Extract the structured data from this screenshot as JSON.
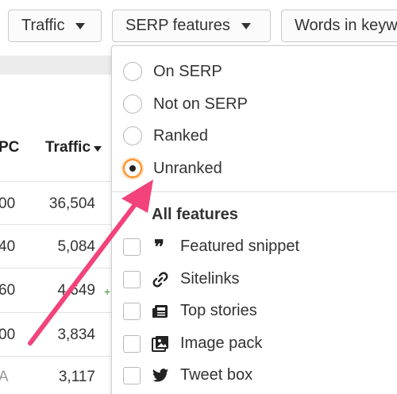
{
  "filters": {
    "traffic": "Traffic",
    "serp_features": "SERP features",
    "words_in_keyword": "Words in keyw"
  },
  "table": {
    "headers": {
      "cpc": "PC",
      "traffic": "Traffic"
    },
    "rows": [
      {
        "cpc": "00",
        "traffic": "36,504"
      },
      {
        "cpc": "40",
        "traffic": "5,084"
      },
      {
        "cpc": "60",
        "traffic": "4,649",
        "delta": "+"
      },
      {
        "cpc": "00",
        "traffic": "3,834"
      },
      {
        "cpc": "A",
        "traffic": "3,117"
      }
    ]
  },
  "dropdown": {
    "radio_options": [
      "On SERP",
      "Not on SERP",
      "Ranked",
      "Unranked"
    ],
    "selected": "Unranked",
    "all_features": "All features",
    "features": [
      "Featured snippet",
      "Sitelinks",
      "Top stories",
      "Image pack",
      "Tweet box"
    ]
  },
  "colors": {
    "accent": "#ff8b1f",
    "arrow": "#f2437a"
  }
}
